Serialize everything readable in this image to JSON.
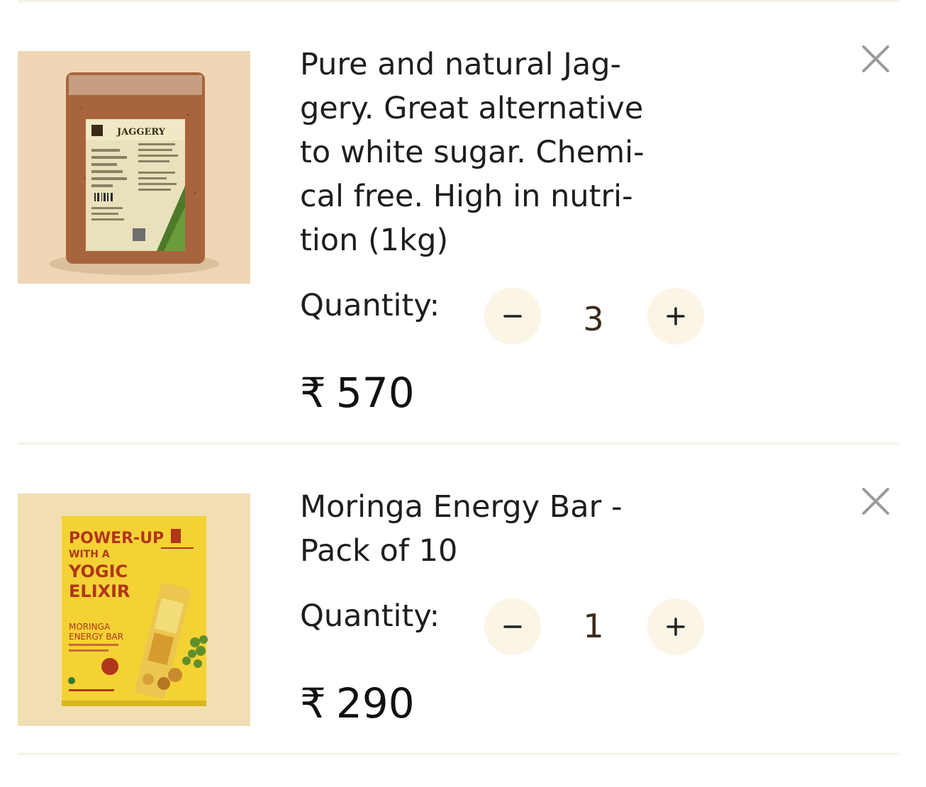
{
  "cart": {
    "items": [
      {
        "title_lines": [
          "Pure and natural Jag-",
          "gery. Great alternative",
          "to white sugar. Chemi-",
          "cal free. High in nutri-",
          "tion (1kg)"
        ],
        "quantity_label": "Quantity:",
        "quantity": "3",
        "currency": "₹",
        "price": "570",
        "image": {
          "package_label": "JAGGERY",
          "background": "#efd6b5",
          "package_color": "#a8653d"
        }
      },
      {
        "title_lines": [
          "Moringa Energy Bar -",
          "Pack of 10"
        ],
        "quantity_label": "Quantity:",
        "quantity": "1",
        "currency": "₹",
        "price": "290",
        "image": {
          "box_lines": [
            "POWER-UP",
            "WITH A",
            "YOGIC",
            "ELIXIR"
          ],
          "product_lines": [
            "MORINGA",
            "ENERGY BAR"
          ],
          "background": "#f1dfb3",
          "box_color": "#f5d233"
        }
      }
    ],
    "icons": {
      "remove": "close-icon",
      "decrement": "minus-icon",
      "increment": "plus-icon"
    },
    "colors": {
      "qty_button_bg": "#fbf5e6",
      "divider": "#f7f2e6"
    }
  }
}
